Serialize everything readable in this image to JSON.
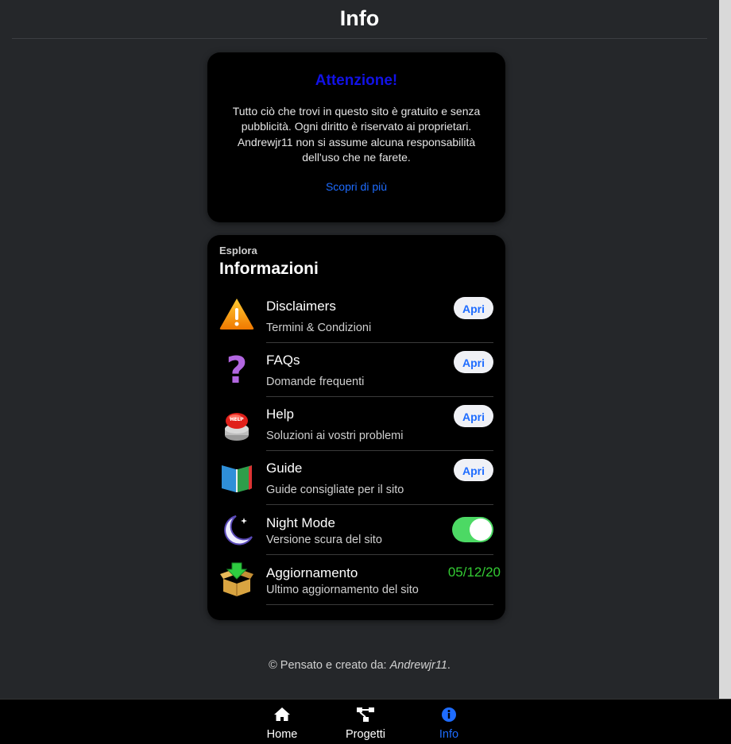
{
  "header": {
    "title": "Info"
  },
  "notice": {
    "title": "Attenzione!",
    "body": "Tutto ciò che trovi in questo sito è gratuito e senza pubblicità. Ogni diritto è riservato ai proprietari. Andrewjr11 non si assume alcuna responsabilità dell'uso che ne farete.",
    "link": "Scopri di più"
  },
  "section": {
    "eyebrow": "Esplora",
    "title": "Informazioni",
    "items": [
      {
        "title": "Disclaimers",
        "subtitle": "Termini & Condizioni",
        "icon": "warning-icon",
        "action": "Apri"
      },
      {
        "title": "FAQs",
        "subtitle": "Domande frequenti",
        "icon": "question-icon",
        "action": "Apri"
      },
      {
        "title": "Help",
        "subtitle": "Soluzioni ai vostri problemi",
        "icon": "help-button-icon",
        "action": "Apri"
      },
      {
        "title": "Guide",
        "subtitle": "Guide consigliate per il sito",
        "icon": "book-icon",
        "action": "Apri"
      },
      {
        "title": "Night Mode",
        "subtitle": "Versione scura del sito",
        "icon": "moon-icon",
        "toggle_on": true
      },
      {
        "title": "Aggiornamento",
        "subtitle": "Ultimo aggiornamento del sito",
        "icon": "update-box-icon",
        "value": "05/12/20"
      }
    ]
  },
  "footer": {
    "prefix": "© Pensato e creato da: ",
    "author": "Andrewjr11",
    "suffix": "."
  },
  "tabbar": {
    "tabs": [
      {
        "label": "Home",
        "icon": "home-icon"
      },
      {
        "label": "Progetti",
        "icon": "sitemap-icon"
      },
      {
        "label": "Info",
        "icon": "info-icon",
        "active": true
      }
    ]
  },
  "colors": {
    "accent": "#1e6cff",
    "notice_title": "#1212e6",
    "toggle_on": "#4cd964",
    "date": "#33cc33"
  }
}
